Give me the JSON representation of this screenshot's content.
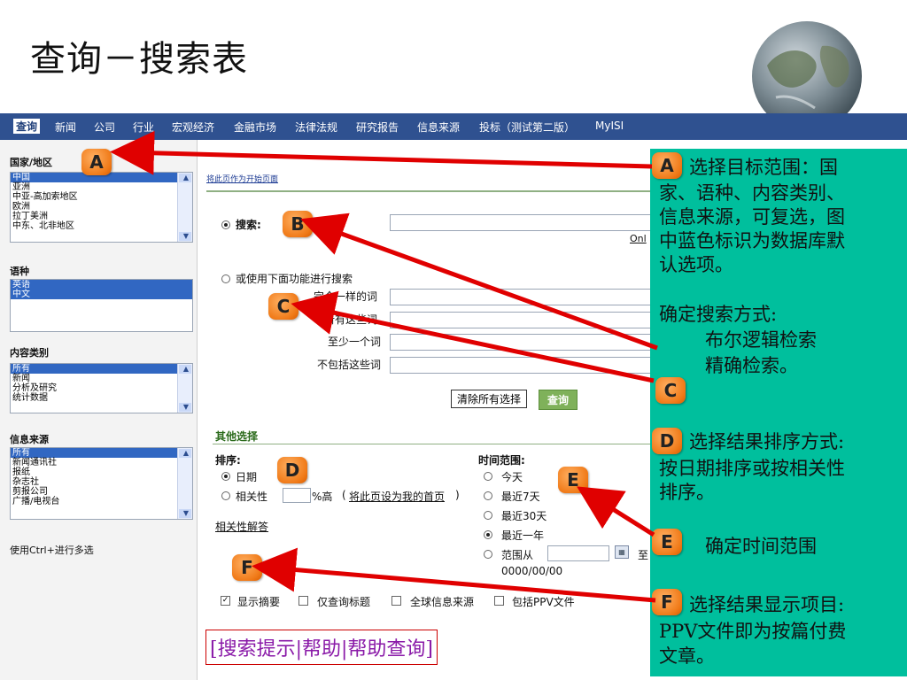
{
  "slide_title": "查询－搜索表",
  "nav": {
    "items": [
      "查询",
      "新闻",
      "公司",
      "行业",
      "宏观经济",
      "金融市场",
      "法律法规",
      "研究报告",
      "信息来源",
      "投标（测试第二版）",
      "MyISI"
    ]
  },
  "sidebar": {
    "country_label": "国家/地区",
    "country_options": [
      "中国",
      "亚洲",
      "中亚-高加索地区",
      "欧洲",
      "拉丁美洲",
      "中东、北非地区"
    ],
    "language_label": "语种",
    "language_options": [
      "英语",
      "中文"
    ],
    "content_label": "内容类别",
    "content_options": [
      "所有",
      "新闻",
      "分析及研究",
      "统计数据"
    ],
    "source_label": "信息来源",
    "source_options": [
      "所有",
      "新闻通讯社",
      "报纸",
      "杂志社",
      "剪报公司",
      "广播/电视台"
    ],
    "multi_hint": "使用Ctrl+进行多选"
  },
  "main": {
    "set_home_link": "将此页作为开始页面",
    "search_label": "搜索:",
    "only_link": "Onl",
    "advanced_label": "或使用下面功能进行搜索",
    "exact_label": "完全一样的词",
    "all_label": "所有这些词",
    "any_label": "至少一个词",
    "none_label": "不包括这些词",
    "clear_button": "清除所有选择",
    "query_button": "查询",
    "other_options": "其他选择",
    "sort_label": "排序:",
    "sort_date": "日期",
    "sort_relevance": "相关性",
    "relevance_suffix": "%高",
    "relevance_link_pre": "(",
    "relevance_link": "将此页设为我的首页",
    "relevance_link_post": ")",
    "relevance_help": "相关性解答",
    "time_label": "时间范围:",
    "time_today": "今天",
    "time_7": "最近7天",
    "time_30": "最近30天",
    "time_year": "最近一年",
    "time_range": "范围从",
    "time_to": "至",
    "date_placeholder": "0000/00/00",
    "opt_summary": "显示摘要",
    "opt_title_only": "仅查询标题",
    "opt_global": "全球信息来源",
    "opt_ppv": "包括PPV文件",
    "help_links": "[搜索提示|帮助|帮助查询]"
  },
  "badges": {
    "a": "A",
    "b": "B",
    "c": "C",
    "d": "D",
    "e": "E",
    "f": "F"
  },
  "panel": {
    "a_text_1": " 选择目标范围：国",
    "a_text_2": "家、语种、内容类别、",
    "a_text_3": "信息来源，可复选，图",
    "a_text_4": "中蓝色标识为数据库默",
    "a_text_5": "认选项。",
    "method_1": "确定搜索方式:",
    "method_2": "布尔逻辑检索",
    "method_3": "精确检索。",
    "d_text_1": " 选择结果排序方式:",
    "d_text_2": "按日期排序或按相关性",
    "d_text_3": "排序。",
    "e_text": "确定时间范围",
    "f_text_1": " 选择结果显示项目:",
    "f_text_2": "PPV文件即为按篇付费",
    "f_text_3": "文章。"
  },
  "colors": {
    "nav_bg": "#2f5190",
    "panel_bg": "#00bf9d",
    "badge": "#f07a18",
    "arrow": "#e00000",
    "section_title": "#2a6a1a"
  }
}
